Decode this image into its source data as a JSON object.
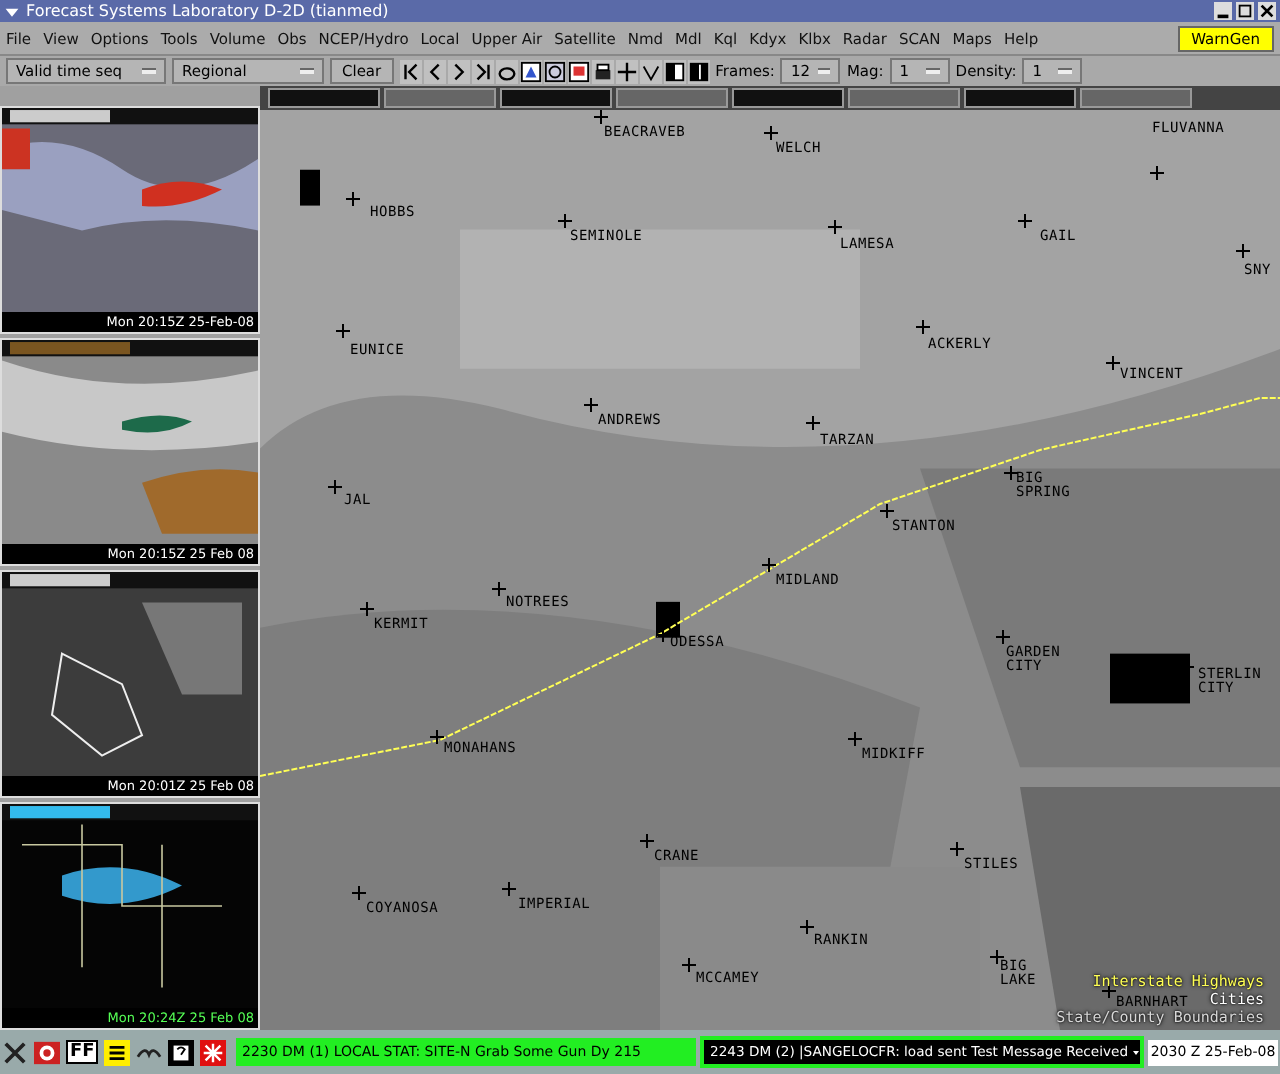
{
  "window": {
    "title": "Forecast Systems Laboratory D-2D (tianmed)"
  },
  "menu": [
    "File",
    "View",
    "Options",
    "Tools",
    "Volume",
    "Obs",
    "NCEP/Hydro",
    "Local",
    "Upper Air",
    "Satellite",
    "Nmd",
    "Mdl",
    "Kql",
    "Kdyx",
    "Klbx",
    "Radar",
    "SCAN",
    "Maps",
    "Help"
  ],
  "warngen_button": "WarnGen",
  "toolbar": {
    "loop_mode": "Valid time seq",
    "scale": "Regional",
    "clear": "Clear",
    "frames_label": "Frames:",
    "frames": "12",
    "mag_label": "Mag:",
    "mag": "1",
    "density_label": "Density:",
    "density": "1"
  },
  "panels": [
    {
      "timestamp": "Mon 20:15Z 25-Feb-08"
    },
    {
      "timestamp": "Mon 20:15Z 25 Feb 08"
    },
    {
      "timestamp": "Mon 20:01Z 25 Feb 08"
    },
    {
      "timestamp": "Mon 20:24Z 25 Feb 08"
    }
  ],
  "map": {
    "cities": [
      {
        "name": "BEACRAVEB"
      },
      {
        "name": "WELCH"
      },
      {
        "name": "FLUVANNA"
      },
      {
        "name": "HOBBS"
      },
      {
        "name": "SEMINOLE"
      },
      {
        "name": "LAMESA"
      },
      {
        "name": "GAIL"
      },
      {
        "name": "SNY"
      },
      {
        "name": "EUNICE"
      },
      {
        "name": "ACKERLY"
      },
      {
        "name": "VINCENT"
      },
      {
        "name": "ANDREWS"
      },
      {
        "name": "TARZAN"
      },
      {
        "name": "BIG SPRING"
      },
      {
        "name": "JAL"
      },
      {
        "name": "STANTON"
      },
      {
        "name": "MIDLAND"
      },
      {
        "name": "NOTREES"
      },
      {
        "name": "KERMIT"
      },
      {
        "name": "ODESSA"
      },
      {
        "name": "GARDEN CITY"
      },
      {
        "name": "STERLIN CITY"
      },
      {
        "name": "MONAHANS"
      },
      {
        "name": "MIDKIFF"
      },
      {
        "name": "CRANE"
      },
      {
        "name": "STILES"
      },
      {
        "name": "COYANOSA"
      },
      {
        "name": "IMPERIAL"
      },
      {
        "name": "RANKIN"
      },
      {
        "name": "BIG LAKE"
      },
      {
        "name": "MCCAMEY"
      },
      {
        "name": "BARNHART"
      }
    ],
    "legend": [
      {
        "label": "Interstate Highways",
        "color": "#ffff55"
      },
      {
        "label": "Cities",
        "color": "#ffffff"
      },
      {
        "label": "State/County Boundaries",
        "color": "#d8d8d8"
      }
    ]
  },
  "status": {
    "tool_label": "FF",
    "message_1": "2230 DM (1) LOCAL STAT: SITE-N Grab Some Gun Dy 215",
    "message_2": "2243 DM (2) |SANGELOCFR: load sent Test Message Received",
    "clock": "2030 Z 25-Feb-08"
  }
}
